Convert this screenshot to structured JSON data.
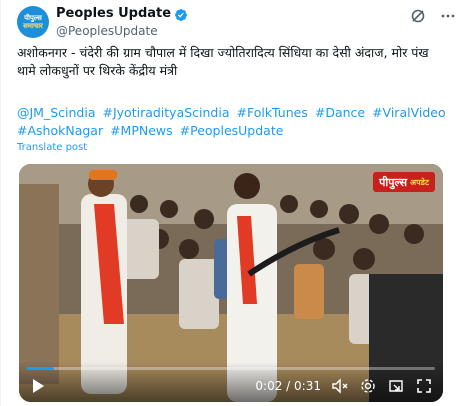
{
  "account": {
    "avatar_line1": "पीपुल्स",
    "avatar_line2": "समाचार",
    "display_name": "Peoples Update",
    "handle": "@PeoplesUpdate"
  },
  "header_icons": [
    "grok-icon",
    "more-icon"
  ],
  "tweet": {
    "text": "अशोकनगर - चंदेरी की ग्राम चौपाल में दिखा ज्योतिरादित्य सिंधिया का देसी अंदाज, मोर पंख थामे लोकधुनों पर थिरके केंद्रीय मंत्री",
    "hashtags": [
      "@JM_Scindia",
      "#JyotiradityaScindia",
      "#FolkTunes",
      "#Dance",
      "#ViralVideo",
      "#AshokNagar",
      "#MPNews",
      "#PeoplesUpdate"
    ],
    "translate_label": "Translate post"
  },
  "video": {
    "watermark_main": "पीपुल्स",
    "watermark_sub": "अपडेट",
    "current_time": "0:02",
    "duration": "0:31",
    "time_display": "0:02 / 0:31",
    "progress_fraction": 0.065
  },
  "colors": {
    "link": "#1d9bf0",
    "verified": "#1d9bf0",
    "watermark_bg": "#c8201c"
  }
}
